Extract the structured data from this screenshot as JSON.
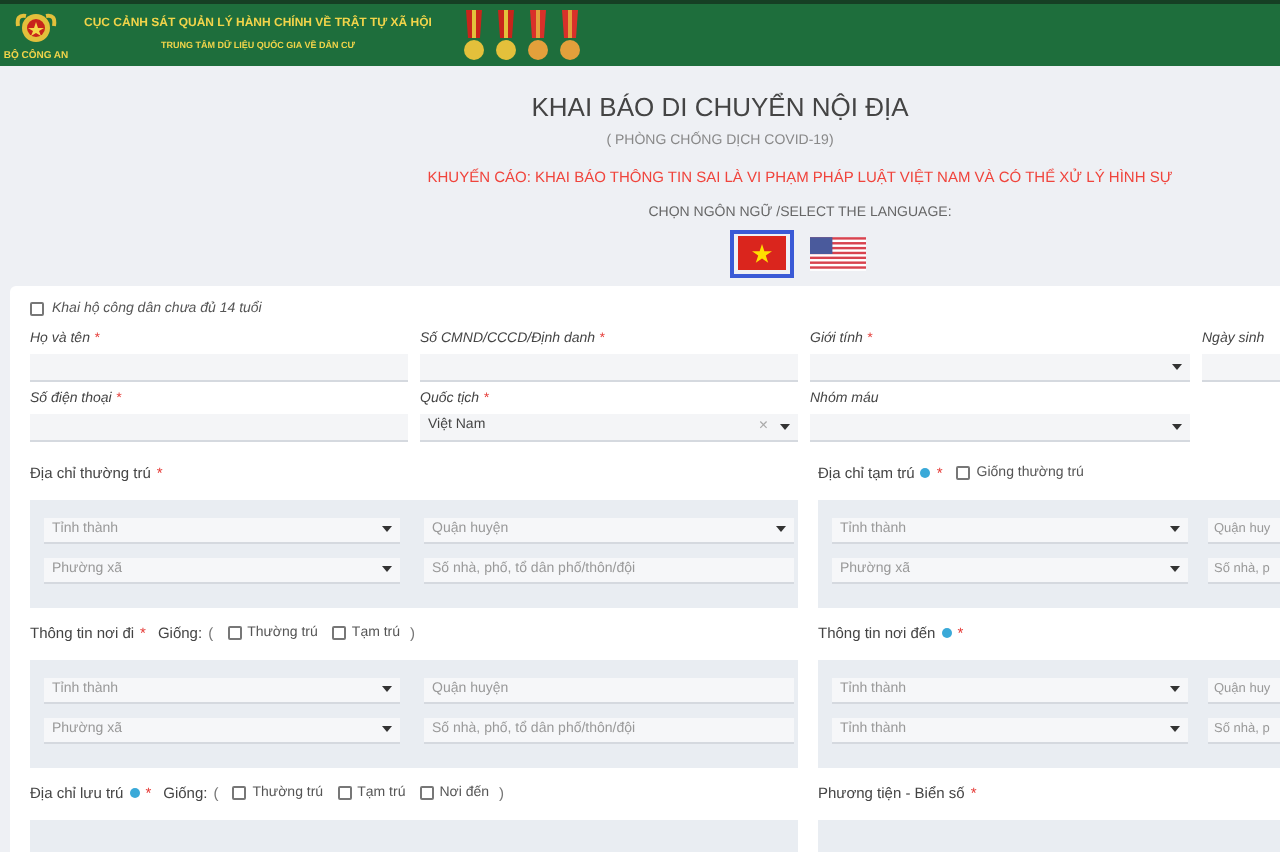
{
  "header": {
    "logo_caption": "BỘ CÔNG AN",
    "agency": "CỤC CẢNH SÁT QUẢN LÝ HÀNH CHÍNH VỀ TRẬT TỰ XÃ HỘI",
    "center": "TRUNG TÂM DỮ LIỆU QUỐC GIA VỀ DÂN CƯ"
  },
  "title": "KHAI BÁO DI CHUYỂN NỘI ĐỊA",
  "subtitle": "( PHÒNG CHỐNG DỊCH COVID-19)",
  "warning": "KHUYẾN CÁO: KHAI BÁO THÔNG TIN SAI LÀ VI PHẠM PHÁP LUẬT VIỆT NAM VÀ CÓ THỂ XỬ LÝ HÌNH SỰ",
  "language_prompt": "CHỌN NGÔN NGỮ /SELECT THE LANGUAGE:",
  "languages": [
    {
      "kind": "vn",
      "selected": true
    },
    {
      "kind": "us",
      "selected": false
    }
  ],
  "minor_checkbox": {
    "label": "Khai hộ công dân chưa đủ 14 tuổi",
    "checked": false
  },
  "field_rows": [
    [
      {
        "label": "Họ và tên",
        "required_mark": "*",
        "kind": "text"
      },
      {
        "label": "Số CMND/CCCD/Định danh",
        "required_mark": "*",
        "kind": "text"
      },
      {
        "label": "Giới tính",
        "required_mark": "*",
        "kind": "select"
      },
      {
        "label": "Ngày sinh",
        "kind": "text"
      }
    ],
    [
      {
        "label": "Số điện thoại",
        "required_mark": "*",
        "kind": "text"
      },
      {
        "label": "Quốc tịch",
        "required_mark": "*",
        "kind": "combo",
        "value": "Việt Nam",
        "clear": "×"
      },
      {
        "label": "Nhóm máu",
        "kind": "select"
      }
    ]
  ],
  "sections": [
    {
      "label": "Địa chỉ thường trú",
      "info": false,
      "required_mark": "*",
      "fields": [
        {
          "kind": "select",
          "placeholder": "Tỉnh thành"
        },
        {
          "kind": "select",
          "placeholder": "Quận huyện"
        },
        {
          "kind": "select",
          "placeholder": "Phường xã"
        },
        {
          "kind": "text",
          "placeholder": "Số nhà, phố, tổ dân phố/thôn/đội"
        }
      ]
    },
    {
      "label": "Địa chỉ tạm trú",
      "info": true,
      "required_mark": "*",
      "options": [
        {
          "label": "Giống thường trú",
          "checked": false
        }
      ],
      "fields": [
        {
          "kind": "select",
          "placeholder": "Tỉnh thành"
        },
        {
          "kind": "text",
          "placeholder": "Quận huy"
        },
        {
          "kind": "select",
          "placeholder": "Phường xã"
        },
        {
          "kind": "text",
          "placeholder": "Số nhà, p"
        }
      ]
    },
    {
      "label": "Thông tin nơi đi",
      "info": false,
      "required_mark": "*",
      "same_label": "Giống:",
      "parens": [
        "(",
        ")"
      ],
      "options": [
        {
          "label": "Thường trú",
          "checked": false
        },
        {
          "label": "Tạm trú",
          "checked": false
        }
      ],
      "fields": [
        {
          "kind": "select",
          "placeholder": "Tỉnh thành"
        },
        {
          "kind": "text",
          "placeholder": "Quận huyện"
        },
        {
          "kind": "select",
          "placeholder": "Phường xã"
        },
        {
          "kind": "text",
          "placeholder": "Số nhà, phố, tổ dân phố/thôn/đội"
        }
      ]
    },
    {
      "label": "Thông tin nơi đến",
      "info": true,
      "required_mark": "*",
      "fields": [
        {
          "kind": "select",
          "placeholder": "Tỉnh thành"
        },
        {
          "kind": "text",
          "placeholder": "Quận huy"
        },
        {
          "kind": "select",
          "placeholder": "Tỉnh thành"
        },
        {
          "kind": "text",
          "placeholder": "Số nhà, p"
        }
      ]
    },
    {
      "label": "Địa chỉ lưu trú",
      "info": true,
      "required_mark": "*",
      "same_label": "Giống:",
      "parens": [
        "(",
        ")"
      ],
      "options": [
        {
          "label": "Thường trú",
          "checked": false
        },
        {
          "label": "Tạm trú",
          "checked": false
        },
        {
          "label": "Nơi đến",
          "checked": false
        }
      ]
    },
    {
      "label": "Phương tiện - Biển số",
      "info": false,
      "required_mark": "*"
    }
  ]
}
